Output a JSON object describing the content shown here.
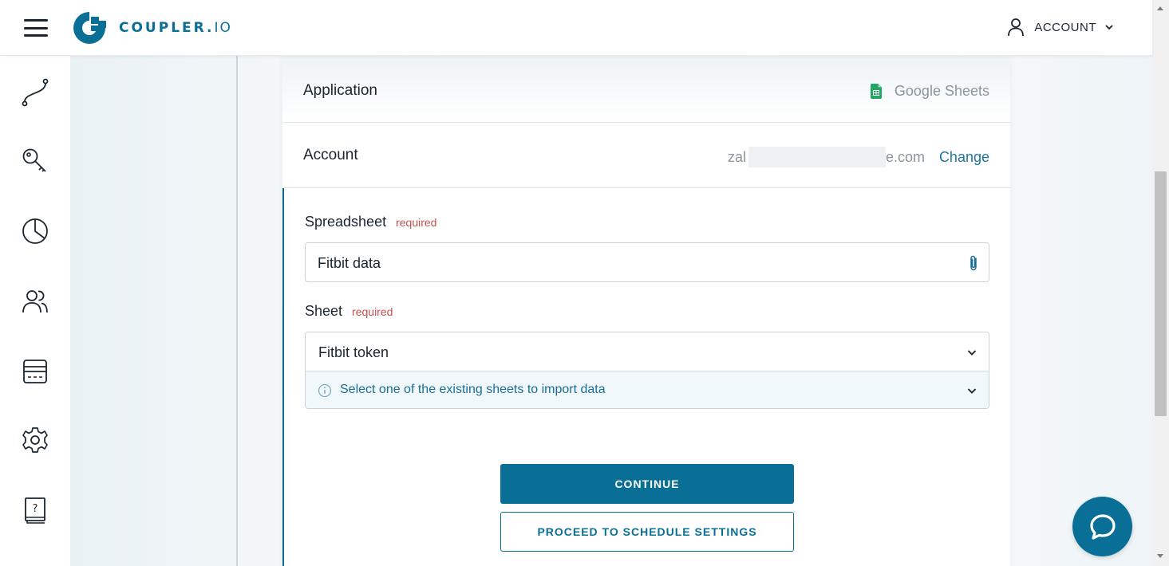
{
  "header": {
    "brand_main": "COUPLER.",
    "brand_suffix": "IO",
    "account_label": "ACCOUNT"
  },
  "sidebar": {
    "items": [
      {
        "icon": "flow-icon"
      },
      {
        "icon": "key-icon"
      },
      {
        "icon": "pie-chart-icon"
      },
      {
        "icon": "users-icon"
      },
      {
        "icon": "billing-icon"
      },
      {
        "icon": "gear-icon"
      },
      {
        "icon": "help-book-icon"
      }
    ]
  },
  "card": {
    "application": {
      "label": "Application",
      "value": "Google Sheets"
    },
    "account": {
      "label": "Account",
      "email_prefix": "zal",
      "email_suffix": "e.com",
      "change_label": "Change"
    },
    "spreadsheet": {
      "label": "Spreadsheet",
      "required": "required",
      "value": "Fitbit data"
    },
    "sheet": {
      "label": "Sheet",
      "required": "required",
      "value": "Fitbit token",
      "hint": "Select one of the existing sheets to import data"
    },
    "continue_label": "CONTINUE",
    "proceed_label": "PROCEED TO SCHEDULE SETTINGS"
  },
  "colors": {
    "brand": "#0a6f96",
    "required": "#c0544d",
    "link": "#1b76a0"
  }
}
